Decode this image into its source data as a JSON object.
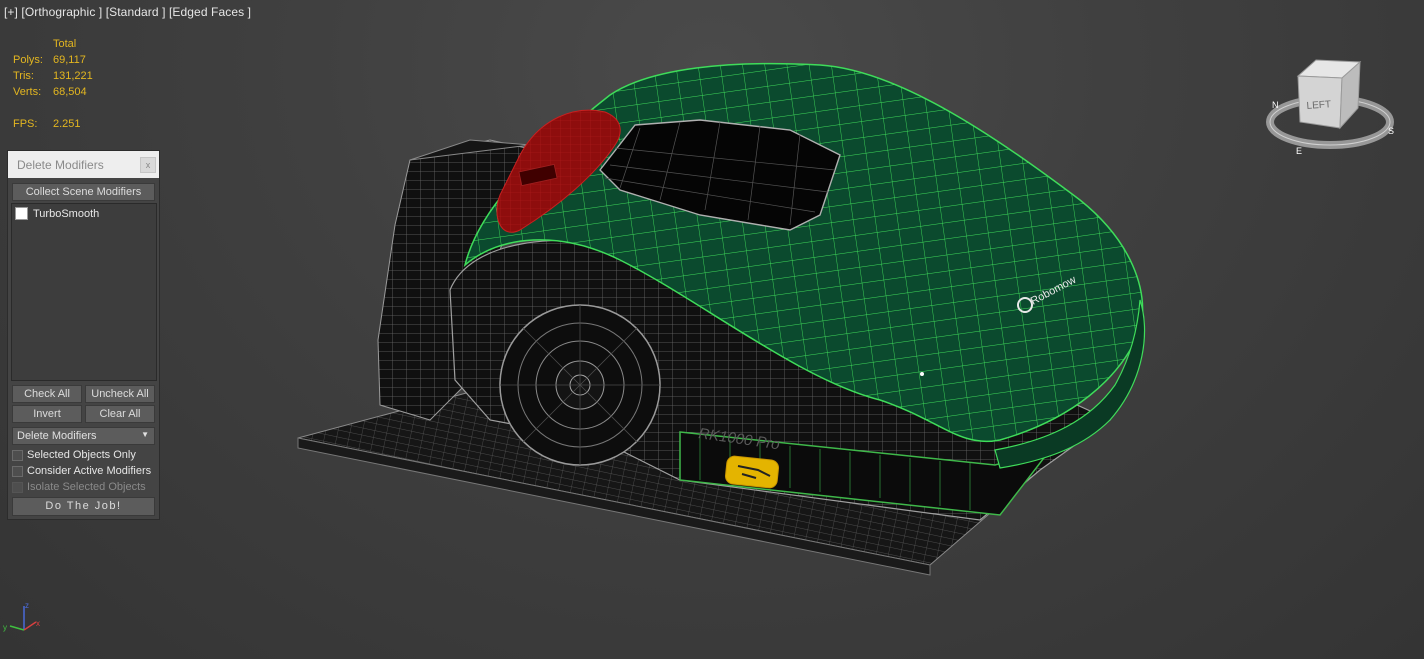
{
  "viewport": {
    "label": "[+] [Orthographic ] [Standard ] [Edged Faces ]"
  },
  "stats": {
    "header": "Total",
    "rows": [
      {
        "label": "Polys:",
        "value": "69,117"
      },
      {
        "label": "Tris:",
        "value": "131,221"
      },
      {
        "label": "Verts:",
        "value": "68,504"
      }
    ],
    "fps_label": "FPS:",
    "fps_value": "2.251",
    "color": "#e3b620"
  },
  "panel": {
    "title": "Delete Modifiers",
    "close_glyph": "x",
    "collect_button": "Collect Scene Modifiers",
    "list_items": [
      {
        "label": "TurboSmooth",
        "checked": false
      }
    ],
    "check_all": "Check All",
    "uncheck_all": "Uncheck All",
    "invert": "Invert",
    "clear_all": "Clear All",
    "dropdown_value": "Delete Modifiers",
    "options": [
      {
        "label": "Selected Objects Only",
        "enabled": true,
        "checked": false
      },
      {
        "label": "Consider Active Modifiers",
        "enabled": true,
        "checked": false
      },
      {
        "label": "Isolate Selected Objects",
        "enabled": false,
        "checked": false
      }
    ],
    "run_button": "Do The Job!"
  },
  "viewcube": {
    "face_label": "LEFT",
    "compass_labels": [
      "S",
      "E",
      "N"
    ]
  },
  "model": {
    "name_text": "RK1000 Pro",
    "brand_text": "Robomow",
    "body_color": "#0b4a2e",
    "wire_color": "#3fdc5a",
    "bumper_color": "#8e0d0d",
    "label_color": "#e4b400"
  },
  "axis_labels": {
    "x": "x",
    "y": "y",
    "z": "z"
  }
}
